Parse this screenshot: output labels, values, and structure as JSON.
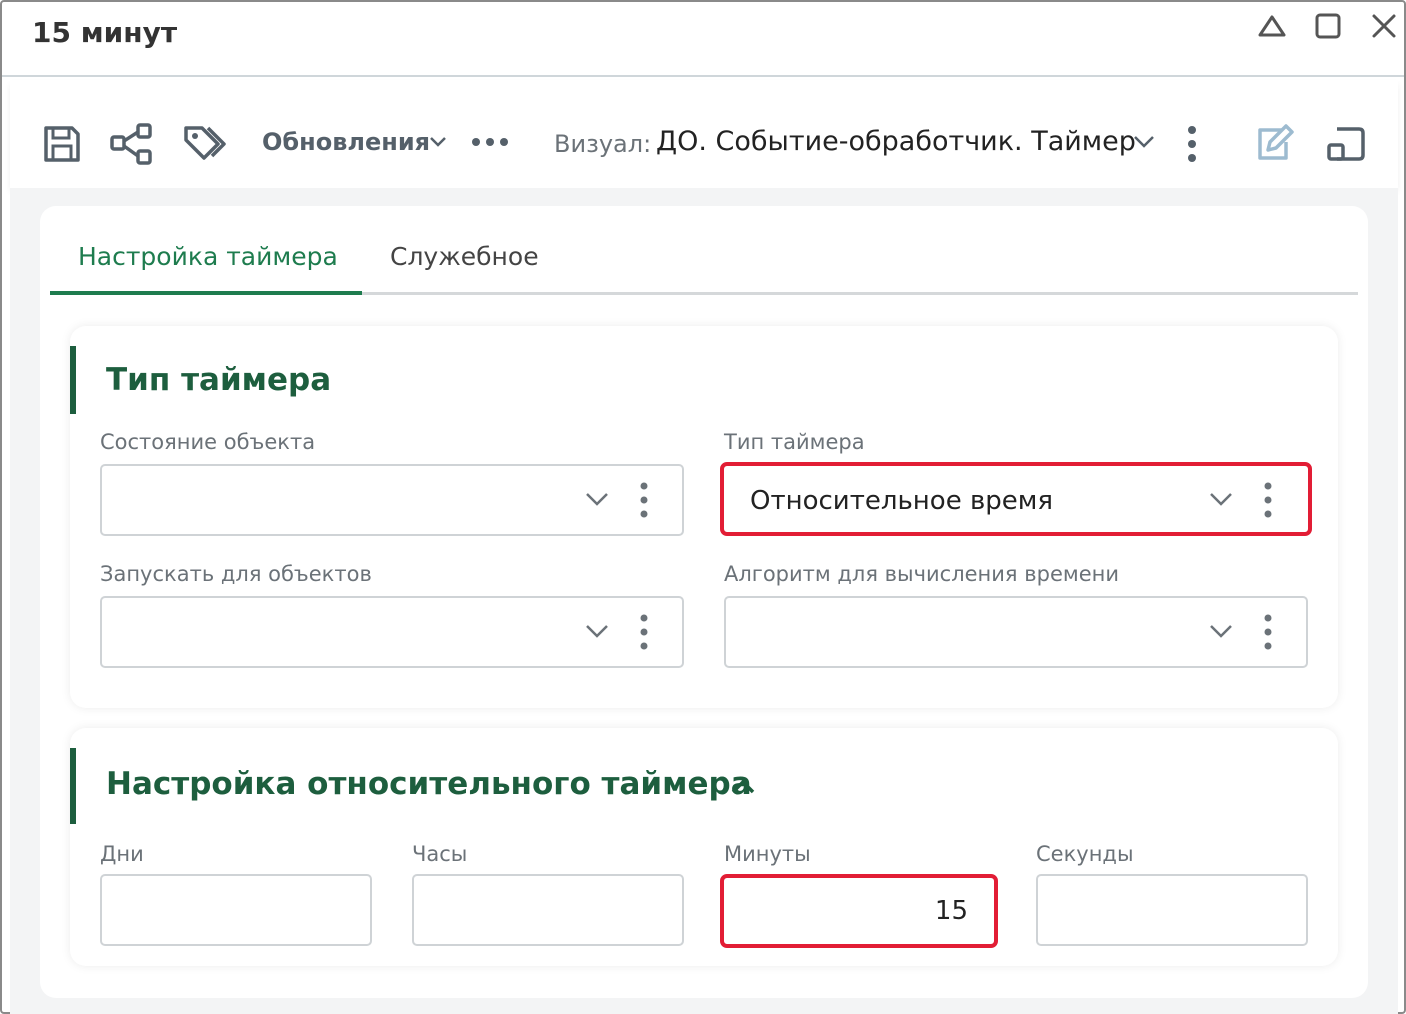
{
  "window": {
    "title": "15 минут"
  },
  "toolbar": {
    "updates_label": "Обновления",
    "visual_prefix": "Визуал:",
    "visual_value": "ДО. Событие-обработчик. Таймер"
  },
  "tabs": [
    {
      "label": "Настройка таймера",
      "active": true
    },
    {
      "label": "Служебное",
      "active": false
    }
  ],
  "timer_type_section": {
    "title": "Тип таймера",
    "fields": {
      "object_state": {
        "label": "Состояние объекта",
        "value": ""
      },
      "timer_type": {
        "label": "Тип таймера",
        "value": "Относительное время"
      },
      "run_for_objects": {
        "label": "Запускать для объектов",
        "value": ""
      },
      "time_algorithm": {
        "label": "Алгоритм для вычисления времени",
        "value": ""
      }
    }
  },
  "relative_section": {
    "title": "Настройка относительного таймера",
    "fields": {
      "days": {
        "label": "Дни",
        "value": ""
      },
      "hours": {
        "label": "Часы",
        "value": ""
      },
      "minutes": {
        "label": "Минуты",
        "value": "15"
      },
      "seconds": {
        "label": "Секунды",
        "value": ""
      }
    }
  },
  "colors": {
    "accent_green": "#1e7c4e",
    "section_green": "#1d5e3e",
    "highlight_red": "#e21d35"
  },
  "icons": [
    "home-icon",
    "maximize-icon",
    "close-icon",
    "save-icon",
    "share-icon",
    "tags-icon",
    "chevron-down-icon",
    "more-horizontal-icon",
    "kebab-icon",
    "edit-icon",
    "open-window-icon",
    "chevron-up-icon"
  ]
}
